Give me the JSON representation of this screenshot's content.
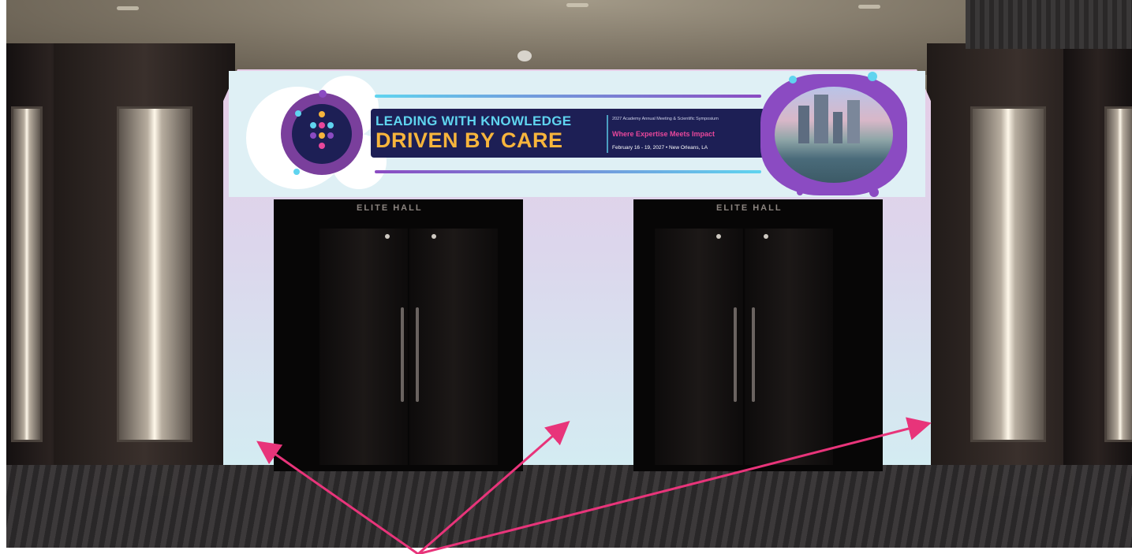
{
  "banner": {
    "headline_line1": "LEADING WITH KNOWLEDGE",
    "headline_line2": "DRIVEN BY CARE",
    "event_line": "2027 Academy Annual Meeting & Scientific Symposium",
    "tagline": "Where Expertise Meets Impact",
    "date_location": "February 16 - 19, 2027 • New Orleans, LA",
    "colors": {
      "navy": "#1d1f55",
      "cyan": "#5fd4ef",
      "gold": "#f7b53c",
      "magenta": "#e8479b",
      "purple": "#8b4bc2"
    }
  },
  "doors": {
    "left_label": "ELITE HALL",
    "right_label": "ELITE HALL"
  },
  "annotation": {
    "arrow_color": "#e8347a",
    "arrow_count": 3
  }
}
